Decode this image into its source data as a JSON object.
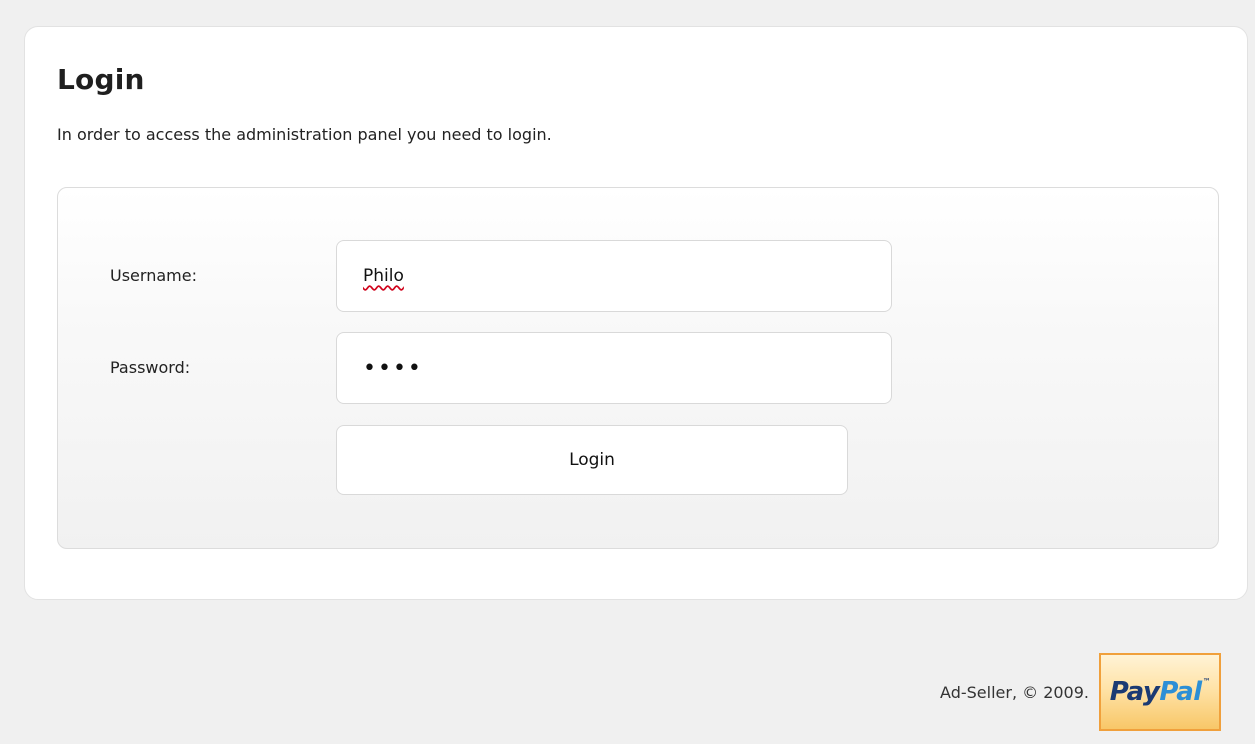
{
  "login": {
    "title": "Login",
    "intro": "In order to access the administration panel you need to login.",
    "username_label": "Username:",
    "username_value": "Philo",
    "password_label": "Password:",
    "password_value": "••••",
    "submit_label": "Login"
  },
  "footer": {
    "copyright": "Ad-Seller, © 2009.",
    "paypal": {
      "pay": "Pay",
      "pal": "Pal",
      "tm": "™"
    }
  },
  "colors": {
    "page_background": "#f0f0f0",
    "card_background": "#ffffff",
    "paypal_dark_blue": "#1b3a73",
    "paypal_light_blue": "#2c8fd6",
    "paypal_border": "#f0a03c"
  }
}
